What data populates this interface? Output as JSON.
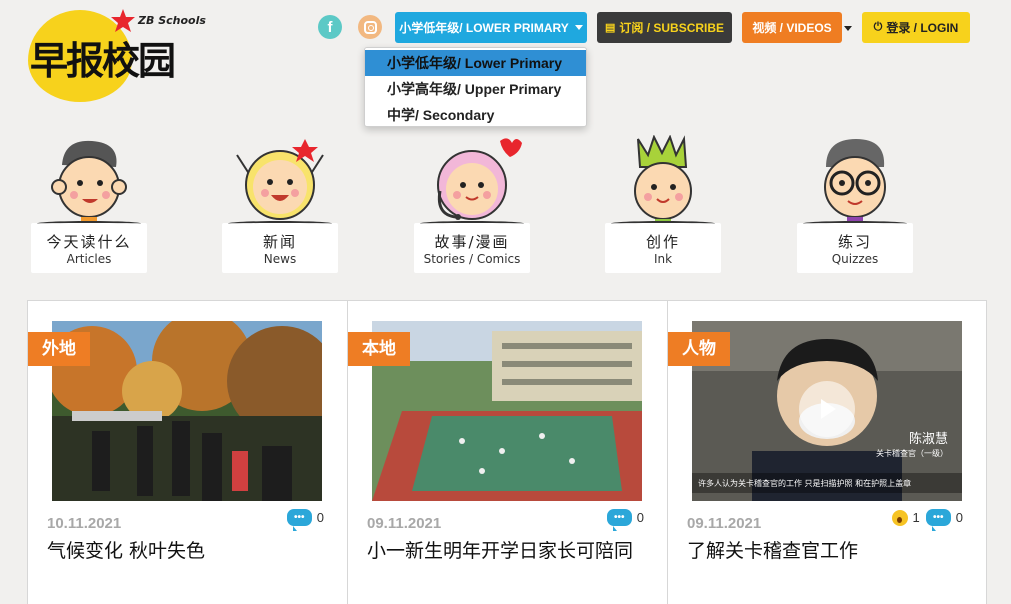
{
  "brand": {
    "logo_text": "早报校园",
    "logo_sub": "ZB Schools"
  },
  "social": {
    "facebook_glyph": "f"
  },
  "nav": {
    "primary_label": "小学低年级/ LOWER PRIMARY",
    "subscribe_label": "订阅 / SUBSCRIBE",
    "videos_label": "视频 / VIDEOS",
    "login_label": "登录 / LOGIN"
  },
  "dropdown": {
    "items": [
      {
        "label": "小学低年级/ Lower Primary",
        "active": true
      },
      {
        "label": "小学高年级/ Upper Primary",
        "active": false
      },
      {
        "label": "中学/ Secondary",
        "active": false
      }
    ]
  },
  "categories": [
    {
      "cn": "今天读什么",
      "en": "Articles"
    },
    {
      "cn": "新闻",
      "en": "News"
    },
    {
      "cn": "故事/漫画",
      "en": "Stories / Comics"
    },
    {
      "cn": "创作",
      "en": "Ink"
    },
    {
      "cn": "练习",
      "en": "Quizzes"
    }
  ],
  "articles": [
    {
      "tag": "外地",
      "date": "10.11.2021",
      "title": "气候变化 秋叶失色",
      "comments": "0"
    },
    {
      "tag": "本地",
      "date": "09.11.2021",
      "title": "小一新生明年开学日家长可陪同",
      "comments": "0"
    },
    {
      "tag": "人物",
      "date": "09.11.2021",
      "title": "了解关卡稽查官工作",
      "wow": "1",
      "comments": "0",
      "video_caption_name": "陈淑慧",
      "video_caption_role": "关卡稽查官（一级）",
      "video_subtitle": "许多人认为关卡稽查官的工作 只是扫描护照 和在护照上盖章"
    }
  ],
  "colors": {
    "accent_blue": "#1fa8df",
    "accent_orange": "#ee7d24",
    "accent_yellow": "#f7d21c",
    "dark": "#3a3a3a"
  }
}
